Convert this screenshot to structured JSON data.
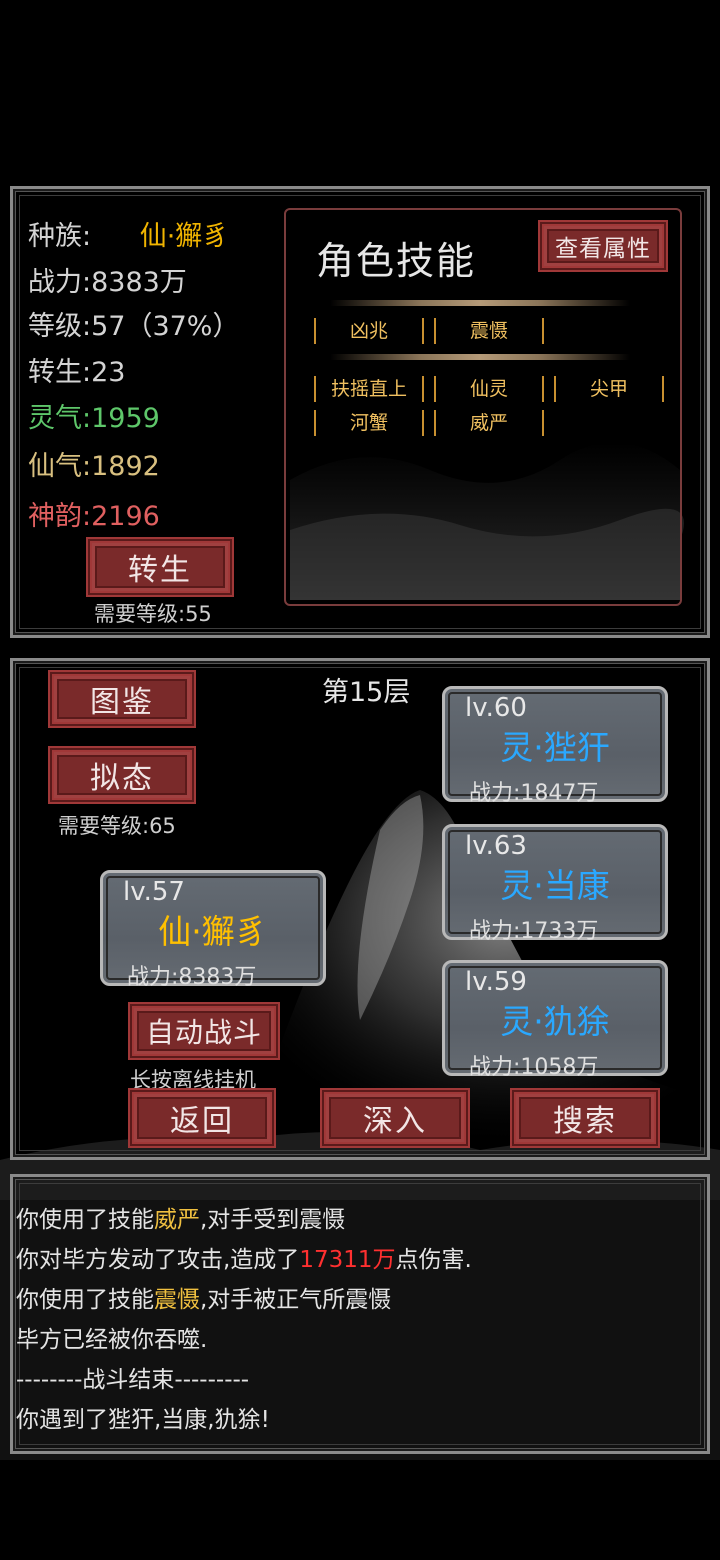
{
  "colors": {
    "accent_gold": "#f0b400",
    "spirit_green": "#5ec76a",
    "immortal_yellow": "#d9c080",
    "charm_red": "#e06060",
    "button_red": "#7a2a2a",
    "monster_blue": "#2aa8ff",
    "damage_red": "#ff3030"
  },
  "stats": {
    "race_label": "种族:",
    "race_value": "仙·獬豸",
    "power": "战力:8383万",
    "level": "等级:57（37%）",
    "rebirth": "转生:23",
    "spirit": "灵气:1959",
    "immortal": "仙气:1892",
    "charm": "神韵:2196",
    "rebirth_button": "转生",
    "rebirth_req": "需要等级:55"
  },
  "skills": {
    "title": "角色技能",
    "view_attr_button": "查看属性",
    "row1": [
      "凶兆",
      "震慑"
    ],
    "row2": [
      "扶摇直上",
      "仙灵",
      "尖甲"
    ],
    "row3": [
      "河蟹",
      "威严"
    ]
  },
  "battle": {
    "floor": "第15层",
    "codex_button": "图鉴",
    "mimic_button": "拟态",
    "mimic_req": "需要等级:65",
    "auto_button": "自动战斗",
    "auto_hint": "长按离线挂机",
    "back_button": "返回",
    "deeper_button": "深入",
    "search_button": "搜索",
    "player": {
      "lv": "lv.57",
      "name": "仙·獬豸",
      "power": "战力:8383万"
    },
    "monsters": [
      {
        "lv": "lv.60",
        "name": "灵·狴犴",
        "power": "战力:1847万"
      },
      {
        "lv": "lv.63",
        "name": "灵·当康",
        "power": "战力:1733万"
      },
      {
        "lv": "lv.59",
        "name": "灵·犰狳",
        "power": "战力:1058万"
      }
    ]
  },
  "log": {
    "l1_a": "你使用了技能",
    "l1_b": "威严",
    "l1_c": ",对手受到震慑",
    "l2_a": "你对毕方发动了攻击,造成了",
    "l2_b": "17311万",
    "l2_c": "点伤害.",
    "l3_a": "你使用了技能",
    "l3_b": "震慑",
    "l3_c": ",对手被正气所震慑",
    "l4": "毕方已经被你吞噬.",
    "l5": "--------战斗结束---------",
    "l6": "你遇到了狴犴,当康,犰狳!"
  }
}
